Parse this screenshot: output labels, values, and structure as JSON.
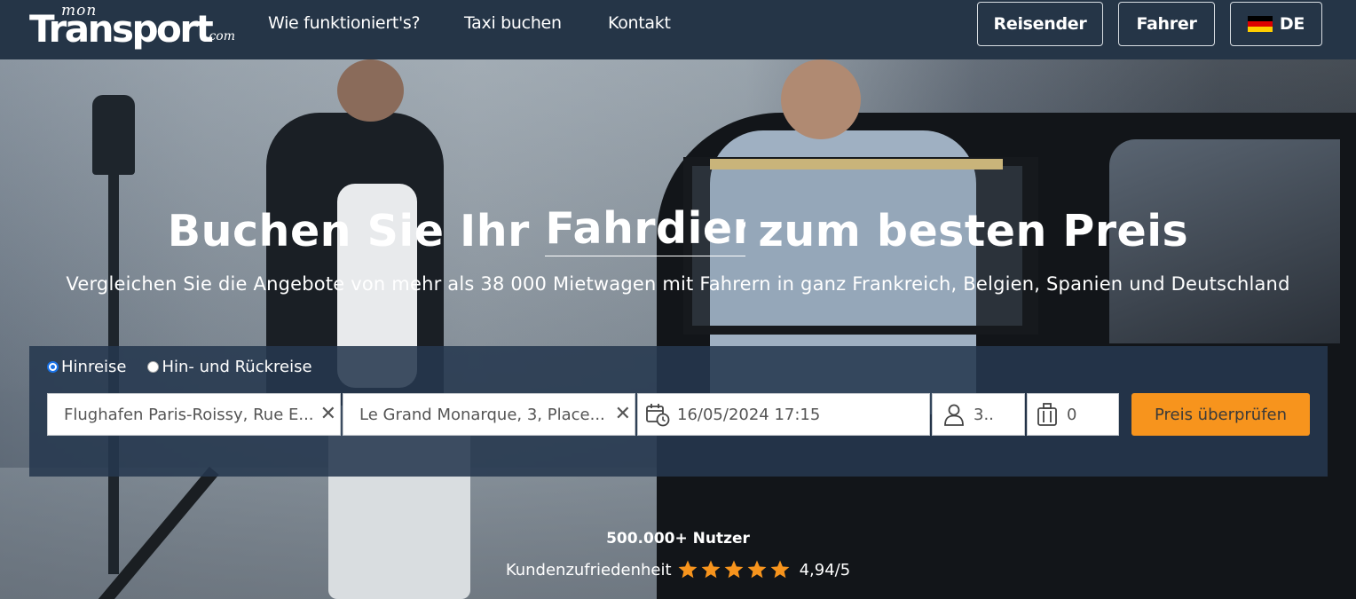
{
  "nav": {
    "logo_mon": "mon",
    "logo_main": "Transport",
    "logo_com": ".com",
    "links": [
      "Wie funktioniert's?",
      "Taxi buchen",
      "Kontakt"
    ],
    "btn_traveler": "Reisender",
    "btn_driver": "Fahrer",
    "btn_language": "DE"
  },
  "hero": {
    "title_before": "Buchen Sie Ihr",
    "title_typed": "Fahrdien",
    "title_after": "zum besten Preis",
    "subtitle": "Vergleichen Sie die Angebote von mehr als 38 000 Mietwagen mit Fahrern in ganz Frankreich, Belgien, Spanien und Deutschland"
  },
  "booking": {
    "trip_type": {
      "one_way": "Hinreise",
      "round_trip": "Hin- und Rückreise",
      "selected": "one_way"
    },
    "from_value": "Flughafen Paris-Roissy, Rue E...",
    "to_value": "Le Grand Monarque, 3, Place...",
    "datetime_value": "16/05/2024 17:15",
    "passengers_value": "3..",
    "luggage_value": "0",
    "submit_label": "Preis überprüfen",
    "clear_glyph": "✕"
  },
  "stats": {
    "users": "500.000+ Nutzer",
    "satisfaction_label": "Kundenzufriedenheit",
    "rating": 4.94,
    "rating_text": "4,94/5",
    "stars_max": 5
  },
  "colors": {
    "navbar": "#253547",
    "accent": "#f7941d",
    "booking_bg": "rgba(38,56,78,0.88)"
  }
}
